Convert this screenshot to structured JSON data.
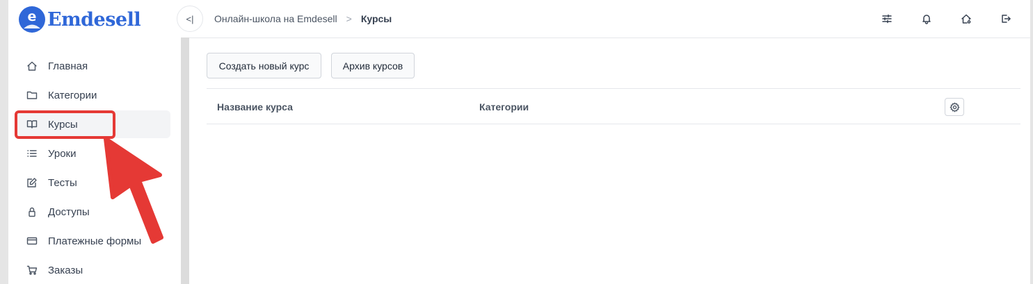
{
  "app": {
    "logo_text": "Emdesell",
    "logo_letter": "e"
  },
  "breadcrumb": {
    "root": "Онлайн-школа на Emdesell",
    "separator": ">",
    "current": "Курсы"
  },
  "topbar": {
    "collapse_label": "<|",
    "icons": [
      "sliders-icon",
      "bell-icon",
      "home-settings-icon",
      "logout-icon"
    ]
  },
  "sidebar": {
    "items": [
      {
        "label": "Главная",
        "icon": "home-icon"
      },
      {
        "label": "Категории",
        "icon": "folder-icon"
      },
      {
        "label": "Курсы",
        "icon": "book-icon",
        "active": true
      },
      {
        "label": "Уроки",
        "icon": "list-icon"
      },
      {
        "label": "Тесты",
        "icon": "edit-icon"
      },
      {
        "label": "Доступы",
        "icon": "lock-icon"
      },
      {
        "label": "Платежные формы",
        "icon": "card-icon"
      },
      {
        "label": "Заказы",
        "icon": "cart-icon"
      }
    ]
  },
  "main": {
    "create_button": "Создать новый курс",
    "archive_button": "Архив курсов",
    "table": {
      "columns": [
        "Название курса",
        "Категории"
      ],
      "rows": []
    }
  },
  "colors": {
    "brand": "#2f67d8",
    "annotation": "#e53935"
  }
}
